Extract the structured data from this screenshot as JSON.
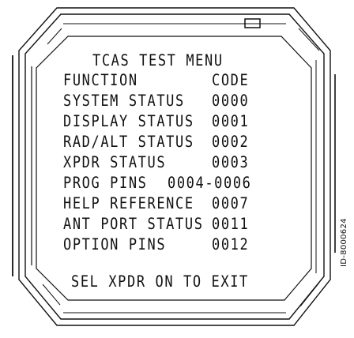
{
  "menu": {
    "title": "TCAS TEST MENU",
    "header": {
      "function": "FUNCTION",
      "code": "CODE"
    },
    "items": [
      {
        "label": "SYSTEM STATUS",
        "code": "0000"
      },
      {
        "label": "DISPLAY STATUS",
        "code": "0001"
      },
      {
        "label": "RAD/ALT STATUS",
        "code": "0002"
      },
      {
        "label": "XPDR STATUS",
        "code": "0003"
      },
      {
        "label": "PROG PINS",
        "code": "0004-0006"
      },
      {
        "label": "HELP REFERENCE",
        "code": "0007"
      },
      {
        "label": "ANT PORT STATUS",
        "code": "0011"
      },
      {
        "label": "OPTION PINS",
        "code": "0012"
      }
    ],
    "footer": "SEL XPDR ON TO EXIT"
  },
  "figure_id": "ID-8000624",
  "colors": {
    "ink": "#111111",
    "background": "#ffffff"
  },
  "icons": {
    "indicator": "rectangle-indicator-icon"
  }
}
